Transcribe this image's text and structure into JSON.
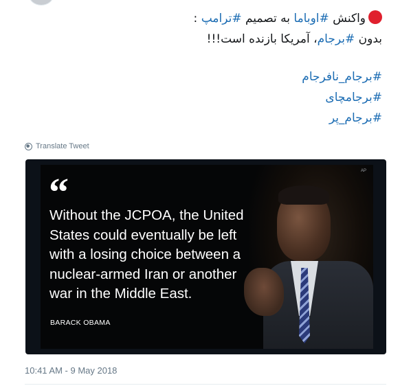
{
  "tweet": {
    "lines": [
      {
        "prefix": "واکنش ",
        "hashtag1": "#اوباما",
        "middle": " به تصمیم ",
        "hashtag2": "#ترامپ",
        "suffix": " :"
      },
      {
        "prefix": "بدون ",
        "hashtag": "#برجام",
        "suffix": "، آمریکا بازنده است!!!"
      }
    ],
    "hashtags": [
      "#برجام_نافرجام",
      "#برجامچای",
      "#برجام_پر"
    ],
    "status_dot_color": "#e0202e",
    "hashtag_color": "#1b6cb3"
  },
  "translate_link": {
    "label": "Translate Tweet",
    "icon": "globe-icon"
  },
  "media": {
    "quote_mark": "“",
    "quote": "Without the JCPOA, the United States could eventually be left with a losing choice between a nuclear-armed Iran or another war in the Middle East.",
    "attribution": "BARACK OBAMA",
    "photo_credit": "AP"
  },
  "timestamp": "10:41 AM - 9 May 2018"
}
